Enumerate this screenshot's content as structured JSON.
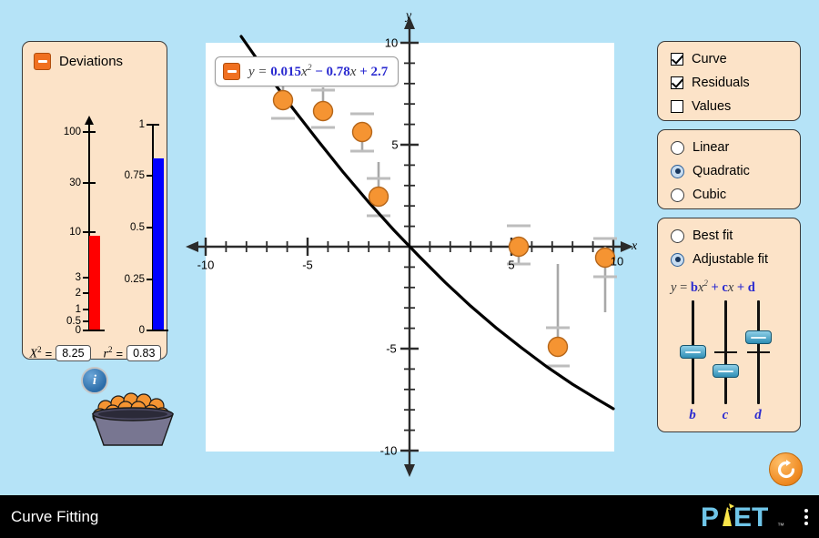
{
  "sim": {
    "title": "Curve Fitting",
    "logo_text": "PhET",
    "menu_icon": "kebab-menu-icon",
    "reset_icon": "reset-all-icon"
  },
  "deviations": {
    "title": "Deviations",
    "minimize_icon": "minimize-icon",
    "info_icon": "info-icon",
    "chi_label": "X",
    "chi_exp": "2",
    "chi_value": "8.25",
    "r_label": "r",
    "r_exp": "2",
    "r_value": "0.83",
    "equals": "=",
    "chi_bar_color": "#ff0000",
    "r_bar_color": "#0000ff",
    "chi_ticks": [
      "100",
      "30",
      "10",
      "3",
      "2",
      "1",
      "0.5",
      "0"
    ],
    "r_ticks": [
      "1",
      "0.75",
      "0.5",
      "0.25",
      "0"
    ]
  },
  "equation_box": {
    "minimize_icon": "minimize-icon",
    "lhs": "y",
    "equals": "=",
    "a_coef": "0.015",
    "x_sq": "x",
    "sq_exp": "2",
    "sign_b": "−",
    "b_coef": "0.78",
    "x_term": "x",
    "sign_c": "+",
    "c_coef": "2.7",
    "color": "#2b2bd0"
  },
  "graph": {
    "x_axis_label": "x",
    "y_axis_label": "y",
    "x_tick_labels": [
      {
        "value": -10,
        "text": "-10"
      },
      {
        "value": -5,
        "text": "-5"
      },
      {
        "value": 5,
        "text": "5"
      },
      {
        "value": 10,
        "text": "10"
      }
    ],
    "y_tick_labels": [
      {
        "value": 10,
        "text": "10"
      },
      {
        "value": 5,
        "text": "5"
      },
      {
        "value": -5,
        "text": "-5"
      },
      {
        "value": -10,
        "text": "-10"
      }
    ],
    "point_color": "#f59432",
    "curve_color": "#000000",
    "residual_color": "#9a9a9a"
  },
  "chart_data": {
    "type": "scatter",
    "title": "",
    "xlabel": "x",
    "ylabel": "y",
    "xlim": [
      -10,
      10
    ],
    "ylim": [
      -10,
      10
    ],
    "grid": false,
    "points": [
      {
        "x": -6.3,
        "y": 8.4,
        "delta": 0.9
      },
      {
        "x": -4.4,
        "y": 7.8,
        "delta": 0.75
      },
      {
        "x": -2.6,
        "y": 6.5,
        "delta": 1.1
      },
      {
        "x": -1.2,
        "y": 4.3,
        "delta": 1.5
      },
      {
        "x": 5.2,
        "y": 0.1,
        "delta": 0.75
      },
      {
        "x": 9.4,
        "y": -0.3,
        "delta": 1.6
      },
      {
        "x": 7.3,
        "y": -5.0,
        "delta": 1.5
      }
    ],
    "fit_curve": {
      "type": "quadratic",
      "a": 0.015,
      "b": -0.78,
      "c": 2.7,
      "equation": "y = 0.015x² - 0.78x + 2.7"
    }
  },
  "view_panel": {
    "options": [
      {
        "label": "Curve",
        "checked": true
      },
      {
        "label": "Residuals",
        "checked": true
      },
      {
        "label": "Values",
        "checked": false
      }
    ]
  },
  "order_panel": {
    "options": [
      {
        "label": "Linear",
        "selected": false
      },
      {
        "label": "Quadratic",
        "selected": true
      },
      {
        "label": "Cubic",
        "selected": false
      }
    ]
  },
  "fit_panel": {
    "options": [
      {
        "label": "Best fit",
        "selected": false
      },
      {
        "label": "Adjustable fit",
        "selected": true
      }
    ],
    "equation": {
      "lhs": "y",
      "equals": "=",
      "b": "b",
      "x_sq": "x",
      "sq_exp": "2",
      "plus1": "+",
      "c": "c",
      "x": "x",
      "plus2": "+",
      "d": "d"
    },
    "sliders": [
      {
        "name": "b",
        "position_pct": 56
      },
      {
        "name": "c",
        "position_pct": 73
      },
      {
        "name": "d",
        "position_pct": 43
      }
    ]
  }
}
